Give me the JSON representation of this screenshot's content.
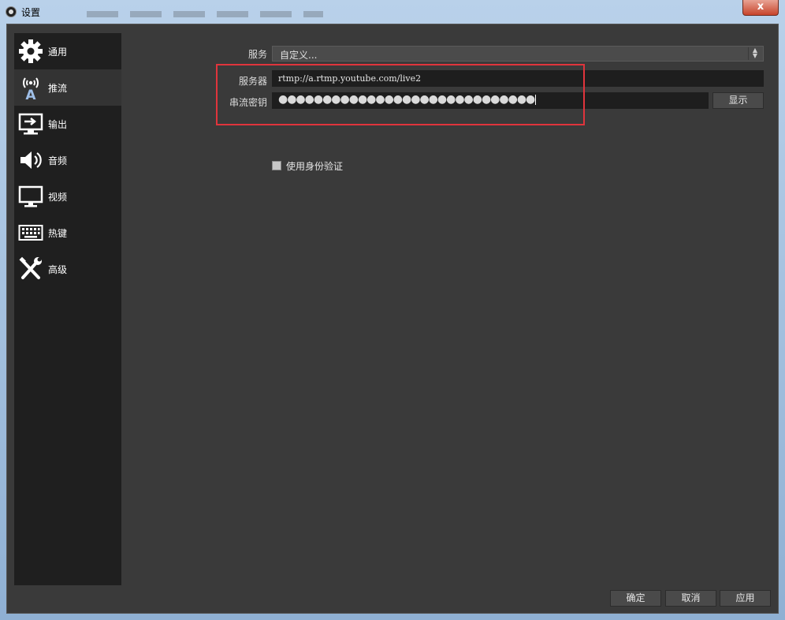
{
  "window": {
    "title": "设置",
    "close_label": "x"
  },
  "sidebar": {
    "items": [
      {
        "label": "通用",
        "icon": "gear-icon"
      },
      {
        "label": "推流",
        "icon": "broadcast-antenna-icon",
        "active": true
      },
      {
        "label": "输出",
        "icon": "output-monitor-icon"
      },
      {
        "label": "音频",
        "icon": "speaker-icon"
      },
      {
        "label": "视频",
        "icon": "monitor-icon"
      },
      {
        "label": "热键",
        "icon": "keyboard-icon"
      },
      {
        "label": "高级",
        "icon": "tools-icon"
      }
    ]
  },
  "stream": {
    "service_label": "服务",
    "service_value": "自定义...",
    "server_label": "服务器",
    "server_value": "rtmp://a.rtmp.youtube.com/live2",
    "key_label": "串流密钥",
    "key_value": "●●●●●●●●●●●●●●●●●●●●●●●●●●●●●",
    "show_button": "显示",
    "auth_checkbox_label": "使用身份验证",
    "auth_checked": false
  },
  "footer": {
    "ok": "确定",
    "cancel": "取消",
    "apply": "应用"
  },
  "colors": {
    "highlight": "#e0343c",
    "panel_bg": "#3a3a3a",
    "sidebar_bg": "#1f1f1f"
  }
}
